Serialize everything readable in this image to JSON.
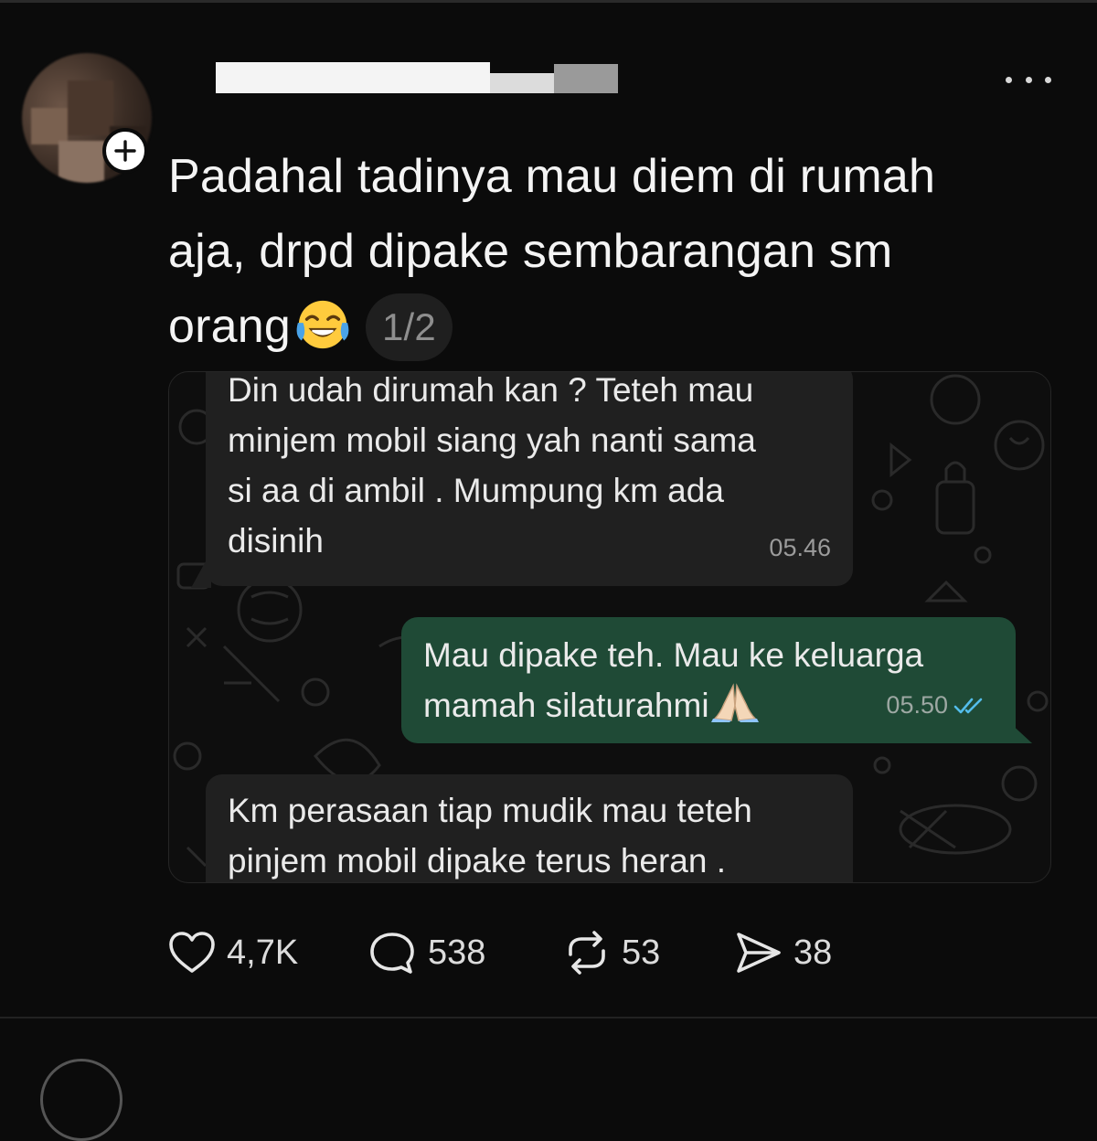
{
  "post": {
    "text_lines": [
      "Padahal tadinya mau diem di rumah",
      "aja, drpd dipake sembarangan sm",
      "orang"
    ],
    "emoji": "face-with-tears-of-joy",
    "page_indicator": "1/2"
  },
  "chat": {
    "messages": [
      {
        "direction": "incoming",
        "lines": [
          "Din udah dirumah kan ? Teteh mau",
          "minjem mobil siang yah nanti sama",
          "si aa di ambil . Mumpung km ada",
          "disinih"
        ],
        "time": "05.46"
      },
      {
        "direction": "outgoing",
        "lines": [
          "Mau dipake teh. Mau ke keluarga",
          "mamah silaturahmi"
        ],
        "emoji": "folded-hands",
        "time": "05.50",
        "status_icon": "double-check-read-icon"
      },
      {
        "direction": "incoming",
        "lines": [
          "Km perasaan tiap mudik mau teteh",
          "pinjem mobil dipake terus heran ."
        ]
      }
    ]
  },
  "actions": {
    "likes": "4,7K",
    "replies": "538",
    "reposts": "53",
    "shares": "38"
  },
  "colors": {
    "background": "#0b0b0b",
    "incoming_bubble": "#202020",
    "outgoing_bubble": "#1f4a36",
    "read_tick": "#53bdeb"
  }
}
